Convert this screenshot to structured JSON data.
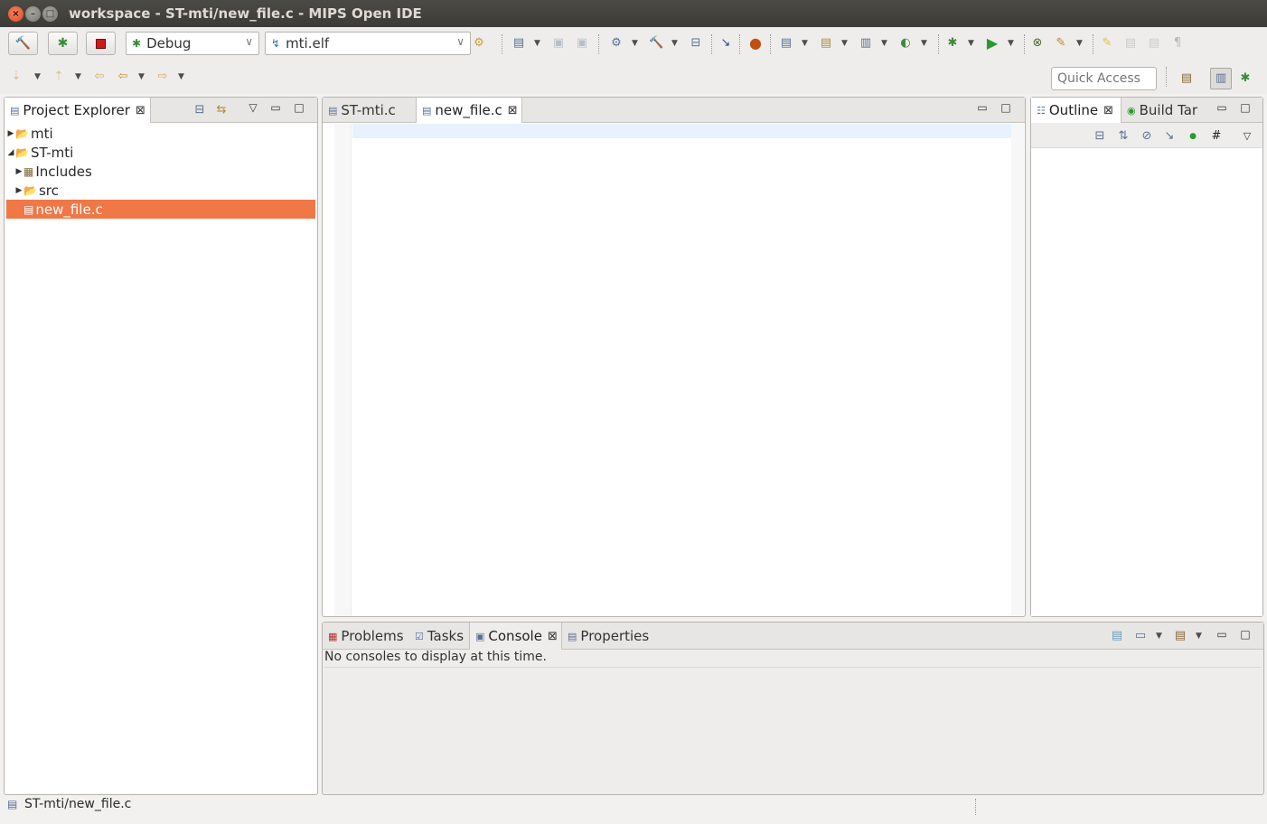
{
  "window": {
    "title": "workspace - ST-mti/new_file.c - MIPS Open IDE"
  },
  "toolbar": {
    "build_config": "Debug",
    "launch_target": "mti.elf"
  },
  "quick_access": {
    "placeholder": "Quick Access"
  },
  "project_explorer": {
    "tab_label": "Project Explorer",
    "tree": [
      {
        "label": "mti",
        "level": 0,
        "expanded": false
      },
      {
        "label": "ST-mti",
        "level": 0,
        "expanded": true
      },
      {
        "label": "Includes",
        "level": 1,
        "expanded": false
      },
      {
        "label": "src",
        "level": 1,
        "expanded": false
      },
      {
        "label": "new_file.c",
        "level": 1,
        "selected": true
      }
    ]
  },
  "editor": {
    "tabs": [
      {
        "label": "ST-mti.c",
        "active": false
      },
      {
        "label": "new_file.c",
        "active": true
      }
    ]
  },
  "outline": {
    "tabs": [
      {
        "label": "Outline",
        "active": true
      },
      {
        "label": "Build Tar",
        "active": false
      }
    ]
  },
  "bottom": {
    "tabs": [
      {
        "label": "Problems"
      },
      {
        "label": "Tasks"
      },
      {
        "label": "Console",
        "active": true
      },
      {
        "label": "Properties"
      }
    ],
    "console_message": "No consoles to display at this time."
  },
  "status": {
    "path": "ST-mti/new_file.c"
  },
  "colors": {
    "selection": "#f07746",
    "titlebar": "#3c3b37",
    "close_button": "#df4a16"
  }
}
